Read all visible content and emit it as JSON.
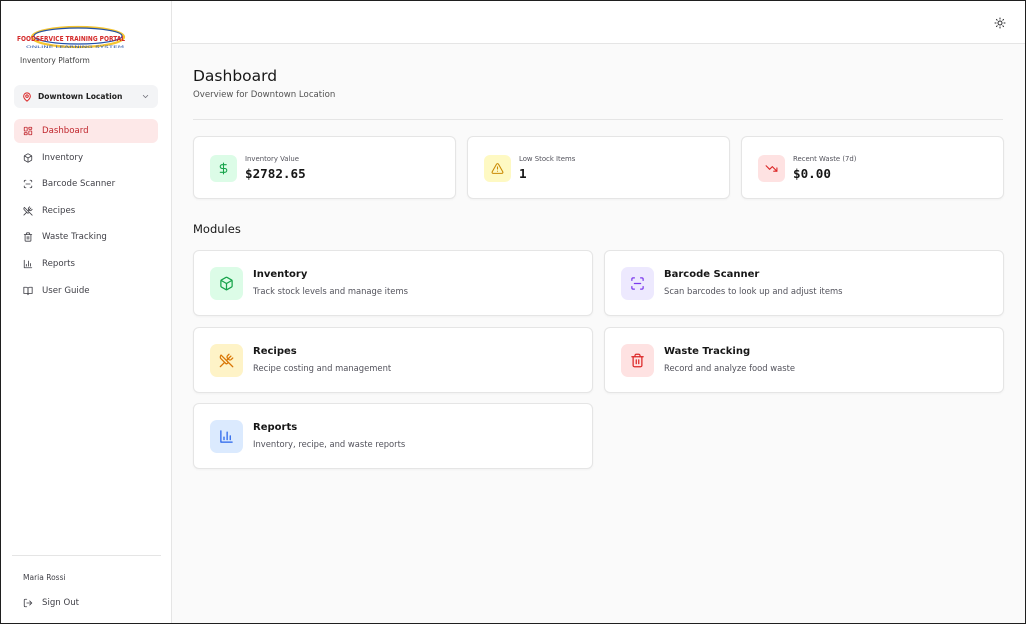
{
  "brand": {
    "logo_text": "FOODSERVICE TRAINING PORTAL",
    "logo_tagline": "ONLINE LEARNING SYSTEM",
    "subtitle": "Inventory Platform",
    "colors": {
      "red": "#d42a2a",
      "blue": "#1f4fa8",
      "yellow": "#f4c430"
    }
  },
  "location_selector": {
    "value": "Downtown Location",
    "icon": "map-pin-icon"
  },
  "sidebar": {
    "items": [
      {
        "label": "Dashboard",
        "icon": "layout-dashboard-icon",
        "active": true
      },
      {
        "label": "Inventory",
        "icon": "package-icon",
        "active": false
      },
      {
        "label": "Barcode Scanner",
        "icon": "scan-icon",
        "active": false
      },
      {
        "label": "Recipes",
        "icon": "utensils-crossed-icon",
        "active": false
      },
      {
        "label": "Waste Tracking",
        "icon": "trash-icon",
        "active": false
      },
      {
        "label": "Reports",
        "icon": "bar-chart-icon",
        "active": false
      },
      {
        "label": "User Guide",
        "icon": "book-open-icon",
        "active": false
      }
    ],
    "user_name": "Maria Rossi",
    "sign_out_label": "Sign Out"
  },
  "header": {
    "theme_toggle_icon": "sun-icon"
  },
  "page": {
    "title": "Dashboard",
    "subtitle": "Overview for Downtown Location"
  },
  "stats": [
    {
      "label": "Inventory Value",
      "value": "$2782.65",
      "icon": "dollar-sign-icon",
      "color": "#16a34a",
      "bg": "#dcfce7"
    },
    {
      "label": "Low Stock Items",
      "value": "1",
      "icon": "alert-triangle-icon",
      "color": "#ca8a04",
      "bg": "#fef9c3"
    },
    {
      "label": "Recent Waste (7d)",
      "value": "$0.00",
      "icon": "trending-down-icon",
      "color": "#dc2626",
      "bg": "#fee2e2"
    }
  ],
  "modules_title": "Modules",
  "modules": [
    {
      "title": "Inventory",
      "desc": "Track stock levels and manage items",
      "icon": "package-icon",
      "color": "#16a34a",
      "bg": "#dcfce7"
    },
    {
      "title": "Barcode Scanner",
      "desc": "Scan barcodes to look up and adjust items",
      "icon": "scan-icon",
      "color": "#7c3aed",
      "bg": "#ede9fe"
    },
    {
      "title": "Recipes",
      "desc": "Recipe costing and management",
      "icon": "utensils-crossed-icon",
      "color": "#d97706",
      "bg": "#fef3c7"
    },
    {
      "title": "Waste Tracking",
      "desc": "Record and analyze food waste",
      "icon": "trash-icon",
      "color": "#dc2626",
      "bg": "#fee2e2"
    },
    {
      "title": "Reports",
      "desc": "Inventory, recipe, and waste reports",
      "icon": "bar-chart-icon",
      "color": "#2563eb",
      "bg": "#dbeafe"
    }
  ]
}
